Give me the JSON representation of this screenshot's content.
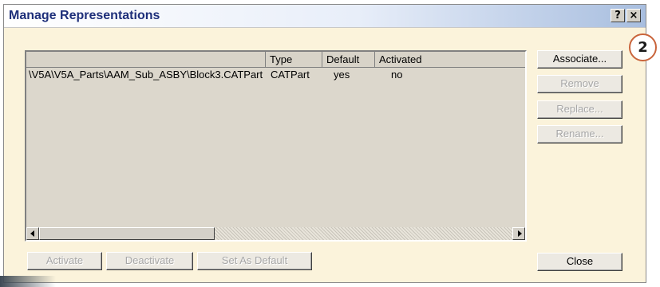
{
  "window": {
    "title": "Manage Representations",
    "help_label": "?",
    "close_label": "×"
  },
  "table": {
    "columns": [
      "",
      "Type",
      "Default",
      "Activated"
    ],
    "rows": [
      {
        "path": "\\V5A\\V5A_Parts\\AAM_Sub_ASBY\\Block3.CATPart",
        "type": "CATPart",
        "default": "yes",
        "activated": "no"
      }
    ]
  },
  "side_buttons": {
    "associate": "Associate...",
    "remove": "Remove",
    "replace": "Replace...",
    "rename": "Rename..."
  },
  "bottom_buttons": {
    "activate": "Activate",
    "deactivate": "Deactivate",
    "set_default": "Set As Default",
    "close": "Close"
  },
  "callout": {
    "label": "2"
  },
  "colors": {
    "dialog_bg": "#fbf3db",
    "title_text": "#1e2f7a",
    "list_bg": "#dcd7cc",
    "callout_border": "#c9643b"
  }
}
